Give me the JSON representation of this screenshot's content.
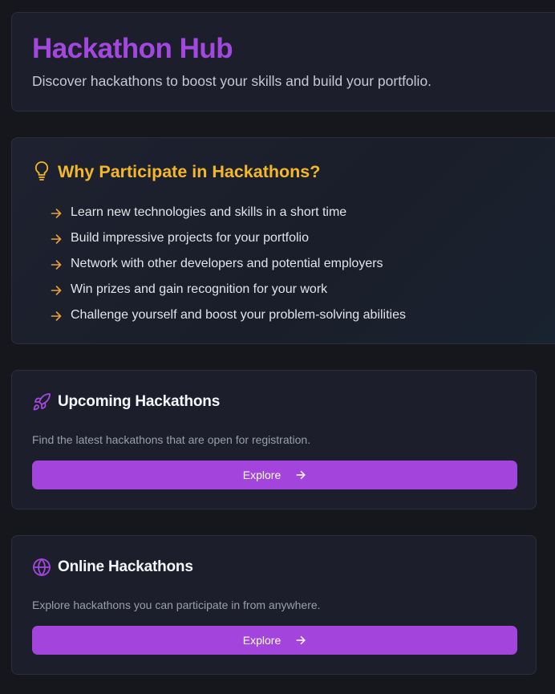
{
  "header": {
    "title": "Hackathon Hub",
    "subtitle": "Discover hackathons to boost your skills and build your portfolio."
  },
  "why": {
    "icon": "lightbulb-icon",
    "title": "Why Participate in Hackathons?",
    "benefits": [
      "Learn new technologies and skills in a short time",
      "Build impressive projects for your portfolio",
      "Network with other developers and potential employers",
      "Win prizes and gain recognition for your work",
      "Challenge yourself and boost your problem-solving abilities"
    ]
  },
  "sections": [
    {
      "icon": "rocket-icon",
      "title": "Upcoming Hackathons",
      "description": "Find the latest hackathons that are open for registration.",
      "button_label": "Explore"
    },
    {
      "icon": "globe-icon",
      "title": "Online Hackathons",
      "description": "Explore hackathons you can participate in from anywhere.",
      "button_label": "Explore"
    }
  ],
  "colors": {
    "background": "#16171c",
    "card": "#1c1f2b",
    "brand_purple": "#a348de",
    "accent_yellow": "#f4b728",
    "arrow_orange": "#e8a33a"
  }
}
